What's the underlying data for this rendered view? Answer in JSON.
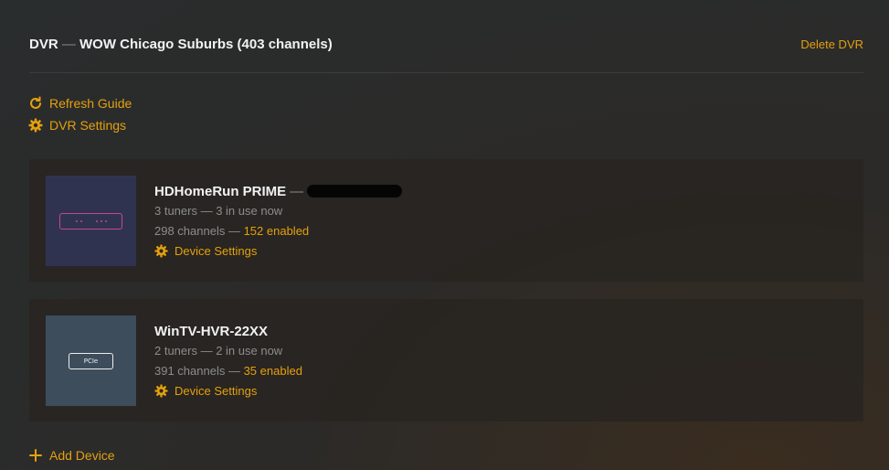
{
  "header": {
    "title_dvr": "DVR",
    "title_sep": "—",
    "title_name": "WOW Chicago Suburbs (403 channels)",
    "delete_label": "Delete DVR"
  },
  "actions": {
    "refresh_label": "Refresh Guide",
    "refresh_icon": "refresh-icon",
    "settings_label": "DVR Settings",
    "settings_icon": "gear-icon",
    "add_label": "Add Device",
    "add_icon": "plus-icon"
  },
  "devices": [
    {
      "name": "HDHomeRun PRIME",
      "name_suffix": "—",
      "tuners": "3 tuners — 3 in use now",
      "channels": "298 channels —",
      "enabled": "152 enabled",
      "settings_label": "Device Settings",
      "thumb_icon": "hdhomerun-device-icon"
    },
    {
      "name": "WinTV-HVR-22XX",
      "tuners": "2 tuners — 2 in use now",
      "channels": "391 channels —",
      "enabled": "35 enabled",
      "settings_label": "Device Settings",
      "thumb_icon": "pcie-card-icon",
      "thumb_label": "PCIe"
    }
  ],
  "colors": {
    "accent": "#e5a00d",
    "hdhr_thumb_bg": "#30334f",
    "hdhr_outline": "#c5468e",
    "pcie_thumb_bg": "#3d4d5c"
  }
}
